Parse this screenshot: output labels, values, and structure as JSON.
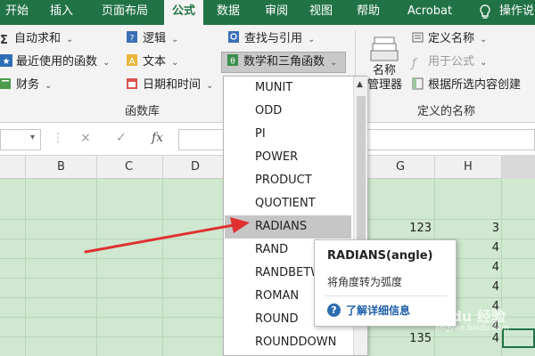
{
  "tabs": [
    {
      "label": "开始",
      "active": false
    },
    {
      "label": "插入",
      "active": false
    },
    {
      "label": "页面布局",
      "active": false
    },
    {
      "label": "公式",
      "active": true
    },
    {
      "label": "数据",
      "active": false
    },
    {
      "label": "审阅",
      "active": false
    },
    {
      "label": "视图",
      "active": false
    },
    {
      "label": "帮助",
      "active": false
    },
    {
      "label": "Acrobat",
      "active": false
    },
    {
      "label": "操作说",
      "active": false
    }
  ],
  "ribbon": {
    "function_library": {
      "autosum": "自动求和",
      "recent": "最近使用的函数",
      "financial": "财务",
      "logical": "逻辑",
      "text": "文本",
      "datetime": "日期和时间",
      "lookup": "查找与引用",
      "math": "数学和三角函数",
      "group_label": "函数库"
    },
    "defined_names": {
      "name_manager_line1": "名称",
      "name_manager_line2": "管理器",
      "define_name": "定义名称",
      "use_in_formula": "用于公式",
      "create_from_selection": "根据所选内容创建",
      "group_label": "定义的名称"
    }
  },
  "formula_bar": {
    "cancel_symbol": "×",
    "enter_symbol": "✓",
    "fx_symbol": "fx"
  },
  "columns": [
    "B",
    "C",
    "D",
    "G",
    "H"
  ],
  "cells": [
    "123",
    "3",
    "4",
    "4",
    "4",
    "4",
    "4",
    "135",
    "4"
  ],
  "dropdown": {
    "items": [
      "MUNIT",
      "ODD",
      "PI",
      "POWER",
      "PRODUCT",
      "QUOTIENT",
      "RADIANS",
      "RAND",
      "RANDBETW",
      "ROMAN",
      "ROUND",
      "ROUNDDOWN"
    ],
    "hovered": "RADIANS"
  },
  "tooltip": {
    "title": "RADIANS(angle)",
    "description": "将角度转为弧度",
    "link": "了解详细信息"
  },
  "watermark": {
    "main": "Baidu 经验",
    "sub": "jingyan.baidu.com"
  },
  "colors": {
    "excel_green": "#217346",
    "grid_green": "#cfe8cf",
    "arrow_red": "#e03030"
  }
}
